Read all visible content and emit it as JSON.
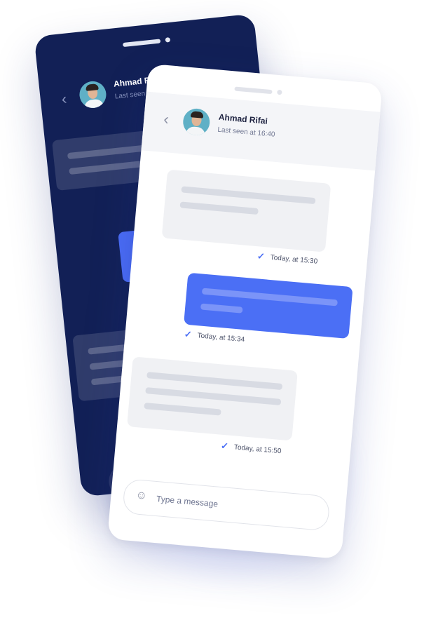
{
  "contact": {
    "name": "Ahmad Rifai",
    "last_seen": "Last seen at 16:40"
  },
  "back_phone": {
    "name_partial": "Ahmad Ri",
    "last_seen_partial": "Last seen a"
  },
  "messages": [
    {
      "direction": "incoming",
      "time": "Today, at 15:30"
    },
    {
      "direction": "outgoing",
      "time": "Today, at 15:34"
    },
    {
      "direction": "incoming",
      "time": "Today, at 15:50"
    }
  ],
  "composer": {
    "placeholder": "Type a message"
  },
  "icons": {
    "back": "chevron-left-icon",
    "emoji": "smiley-icon",
    "read": "checkmark-icon"
  },
  "colors": {
    "dark_phone": "#122056",
    "accent": "#4b6ff5",
    "incoming_bubble": "#f0f1f4"
  }
}
